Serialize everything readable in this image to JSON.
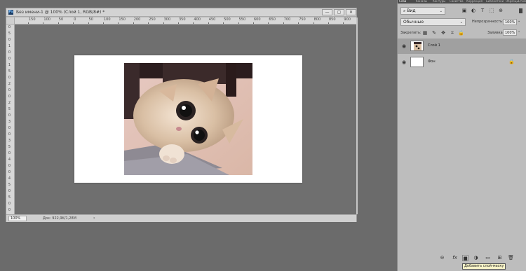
{
  "document": {
    "title": "Без имени-1 @ 100% (Слой 1, RGB/8#) *",
    "app_icon": "Ps",
    "min_glyph": "—",
    "max_glyph": "▢",
    "close_glyph": "✕",
    "zoom": "100%",
    "info": "Док: 922,9K/1,28M",
    "status_arrow": "›",
    "ruler_top": [
      "150",
      "100",
      "50",
      "0",
      "50",
      "100",
      "150",
      "200",
      "250",
      "300",
      "350",
      "400",
      "450",
      "500",
      "550",
      "600",
      "650",
      "700",
      "750",
      "800",
      "850",
      "900",
      "950"
    ],
    "ruler_left": [
      "0",
      "5",
      "0",
      "1",
      "0",
      "0",
      "1",
      "5",
      "0",
      "2",
      "0",
      "0",
      "2",
      "5",
      "0",
      "3",
      "0",
      "0",
      "3",
      "5",
      "0",
      "4",
      "0",
      "0",
      "4",
      "5",
      "0",
      "5",
      "0",
      "0"
    ]
  },
  "panel": {
    "tabs": [
      "Слои",
      "Каналы",
      "Контуры",
      "Свойства",
      "Коррекция",
      "Библиотеки",
      "Образцы",
      "Стили"
    ],
    "kind_filter": "Вид",
    "blend_mode": "Обычные",
    "opacity_label": "Непрозрачность:",
    "opacity_value": "100%",
    "lock_label": "Закрепить:",
    "fill_label": "Заливка:",
    "fill_value": "100%",
    "caret": "⌄",
    "search_glyph": "⌕",
    "filter_icons": [
      "▣",
      "◐",
      "T",
      "⬚",
      "⊕"
    ],
    "lock_icons": [
      "▦",
      "✎",
      "✥",
      "⌗",
      "🔒"
    ],
    "layers": [
      {
        "name": "Слой 1",
        "selected": true,
        "locked": false
      },
      {
        "name": "Фон",
        "selected": false,
        "locked": true
      }
    ],
    "eye_glyph": "◉",
    "lock_glyph": "🔒",
    "bottom_icons": [
      "⊖",
      "fx",
      "■",
      "◑",
      "▭",
      "⊞",
      "🗑"
    ],
    "tooltip": "Добавить слой-маску"
  }
}
